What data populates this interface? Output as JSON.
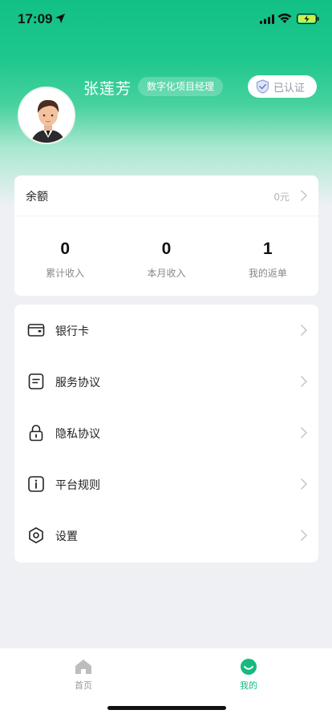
{
  "status_bar": {
    "time": "17:09"
  },
  "profile": {
    "name": "张莲芳",
    "role": "数字化项目经理",
    "verified_label": "已认证"
  },
  "balance": {
    "label": "余额",
    "value": "0元",
    "stats": [
      {
        "value": "0",
        "label": "累计收入"
      },
      {
        "value": "0",
        "label": "本月收入"
      },
      {
        "value": "1",
        "label": "我的返单"
      }
    ]
  },
  "menu": {
    "items": [
      {
        "label": "银行卡",
        "icon": "wallet-icon"
      },
      {
        "label": "服务协议",
        "icon": "document-icon"
      },
      {
        "label": "隐私协议",
        "icon": "lock-icon"
      },
      {
        "label": "平台规则",
        "icon": "info-icon"
      },
      {
        "label": "设置",
        "icon": "settings-icon"
      }
    ]
  },
  "tab_bar": {
    "tabs": [
      {
        "label": "首页",
        "icon": "home-icon",
        "active": false
      },
      {
        "label": "我的",
        "icon": "profile-icon",
        "active": true
      }
    ]
  },
  "colors": {
    "brand_green": "#16b980",
    "muted_text": "#888888",
    "verified_blue": "#8ea2d8"
  }
}
